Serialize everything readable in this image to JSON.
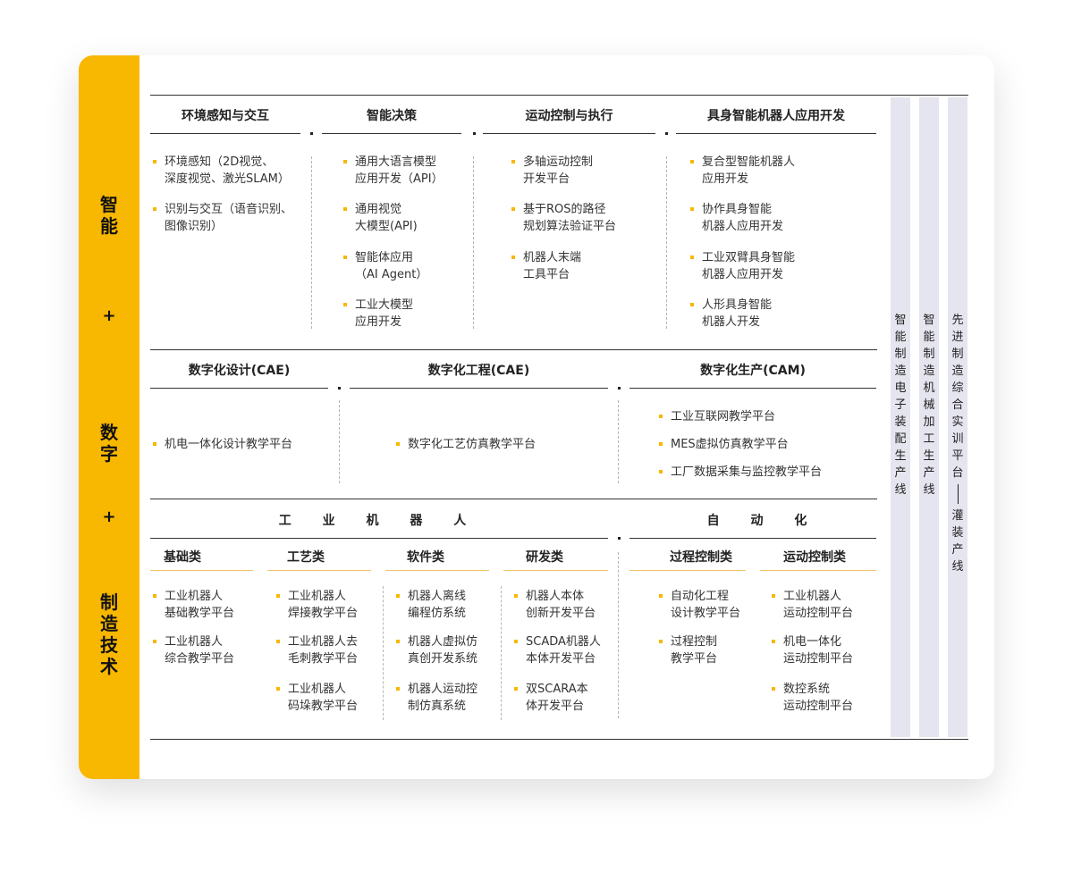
{
  "sidebar": {
    "top": "智能",
    "plus1": "+",
    "middle": "数字",
    "plus2": "+",
    "bottom": "制造技术"
  },
  "section1": {
    "cols": [
      {
        "title": "环境感知与交互",
        "items": [
          {
            "lines": [
              "环境感知（2D视觉、",
              "深度视觉、激光SLAM）"
            ]
          },
          {
            "lines": [
              "识别与交互（语音识别、",
              "图像识别）"
            ]
          }
        ]
      },
      {
        "title": "智能决策",
        "items": [
          {
            "lines": [
              "通用大语言模型",
              "应用开发（API）"
            ]
          },
          {
            "lines": [
              "通用视觉",
              "大模型(API)"
            ]
          },
          {
            "lines": [
              "智能体应用",
              "（AI Agent）"
            ]
          },
          {
            "lines": [
              "工业大模型",
              "应用开发"
            ]
          }
        ]
      },
      {
        "title": "运动控制与执行",
        "items": [
          {
            "lines": [
              "多轴运动控制",
              "开发平台"
            ]
          },
          {
            "lines": [
              "基于ROS的路径",
              "规划算法验证平台"
            ]
          },
          {
            "lines": [
              "机器人末端",
              "工具平台"
            ]
          }
        ]
      },
      {
        "title": "具身智能机器人应用开发",
        "items": [
          {
            "lines": [
              "复合型智能机器人",
              "应用开发"
            ]
          },
          {
            "lines": [
              "协作具身智能",
              "机器人应用开发"
            ]
          },
          {
            "lines": [
              "工业双臂具身智能",
              "机器人应用开发"
            ]
          },
          {
            "lines": [
              "人形具身智能",
              "机器人开发"
            ]
          }
        ]
      }
    ]
  },
  "section2": {
    "cols": [
      {
        "title": "数字化设计(CAE)",
        "items": [
          {
            "lines": [
              "机电一体化设计教学平台"
            ]
          }
        ]
      },
      {
        "title": "数字化工程(CAE)",
        "items": [
          {
            "lines": [
              "数字化工艺仿真教学平台"
            ]
          }
        ]
      },
      {
        "title": "数字化生产(CAM)",
        "items": [
          {
            "lines": [
              "工业互联网教学平台"
            ]
          },
          {
            "lines": [
              "MES虚拟仿真教学平台"
            ]
          },
          {
            "lines": [
              "工厂数据采集与监控教学平台"
            ]
          }
        ]
      }
    ]
  },
  "section3": {
    "group_left": "工 业 机 器 人",
    "group_right": "自 动 化",
    "cols": [
      {
        "title": "基础类",
        "items": [
          {
            "lines": [
              "工业机器人",
              "基础教学平台"
            ]
          },
          {
            "lines": [
              "工业机器人",
              "综合教学平台"
            ]
          }
        ]
      },
      {
        "title": "工艺类",
        "items": [
          {
            "lines": [
              "工业机器人",
              "焊接教学平台"
            ]
          },
          {
            "lines": [
              "工业机器人去",
              "毛刺教学平台"
            ]
          },
          {
            "lines": [
              "工业机器人",
              "码垛教学平台"
            ]
          }
        ]
      },
      {
        "title": "软件类",
        "items": [
          {
            "lines": [
              "机器人离线",
              "编程仿系统"
            ]
          },
          {
            "lines": [
              "机器人虚拟仿",
              "真创开发系统"
            ]
          },
          {
            "lines": [
              "机器人运动控",
              "制仿真系统"
            ]
          }
        ]
      },
      {
        "title": "研发类",
        "items": [
          {
            "lines": [
              "机器人本体",
              "创新开发平台"
            ]
          },
          {
            "lines": [
              "SCADA机器人",
              "本体开发平台"
            ]
          },
          {
            "lines": [
              "双SCARA本",
              "体开发平台"
            ]
          }
        ]
      },
      {
        "title": "过程控制类",
        "items": [
          {
            "lines": [
              "自动化工程",
              "设计教学平台"
            ]
          },
          {
            "lines": [
              "过程控制",
              "教学平台"
            ]
          }
        ]
      },
      {
        "title": "运动控制类",
        "items": [
          {
            "lines": [
              "工业机器人",
              "运动控制平台"
            ]
          },
          {
            "lines": [
              "机电一体化",
              "运动控制平台"
            ]
          },
          {
            "lines": [
              "数控系统",
              "运动控制平台"
            ]
          }
        ]
      }
    ]
  },
  "right_bars": [
    {
      "text": "智能制造电子装配生产线"
    },
    {
      "text": "智能制造机械加工生产线"
    },
    {
      "text_top": "先进制造综合实训平台",
      "text_bottom": "灌装产线"
    }
  ]
}
